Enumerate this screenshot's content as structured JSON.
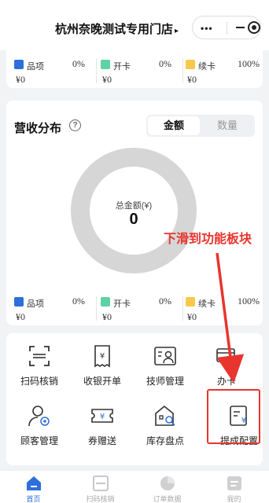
{
  "header": {
    "store_name": "杭州奈晚测试专用门店",
    "dropdown_glyph": "▸"
  },
  "capsule": {
    "more": "•••"
  },
  "summary_legend": [
    {
      "name": "品项",
      "percent": "0%",
      "amount": "¥0",
      "color": "#2e6fdb"
    },
    {
      "name": "开卡",
      "percent": "0%",
      "amount": "¥0",
      "color": "#5fd1a5"
    },
    {
      "name": "续卡",
      "percent": "100%",
      "amount": "¥0",
      "color": "#f7c84a"
    }
  ],
  "revenue": {
    "title": "营收分布",
    "help": "?",
    "toggle": {
      "active": "金额",
      "inactive": "数量"
    },
    "donut_label": "总金额(¥)",
    "donut_value": "0",
    "donut_color": "#d6d6d6"
  },
  "revenue_legend": [
    {
      "name": "品项",
      "percent": "0%",
      "amount": "¥0",
      "color": "#2e6fdb"
    },
    {
      "name": "开卡",
      "percent": "0%",
      "amount": "¥0",
      "color": "#5fd1a5"
    },
    {
      "name": "续卡",
      "percent": "100%",
      "amount": "¥0",
      "color": "#f7c84a"
    }
  ],
  "annotation": {
    "text": "下滑到功能板块",
    "color": "#e8352e"
  },
  "functions": [
    {
      "label": "扫码核销",
      "icon": "scan-icon"
    },
    {
      "label": "收银开单",
      "icon": "receipt-icon"
    },
    {
      "label": "技师管理",
      "icon": "technician-icon"
    },
    {
      "label": "办卡",
      "icon": "card-icon"
    },
    {
      "label": "顾客管理",
      "icon": "customer-icon"
    },
    {
      "label": "券赠送",
      "icon": "coupon-icon"
    },
    {
      "label": "库存盘点",
      "icon": "inventory-icon"
    },
    {
      "label": "提成配置",
      "icon": "commission-icon"
    }
  ],
  "tabbar": [
    {
      "label": "首页",
      "icon": "home-icon",
      "active": true
    },
    {
      "label": "扫码核销",
      "icon": "scan-icon",
      "active": false
    },
    {
      "label": "订单数据",
      "icon": "pie-chart-icon",
      "active": false
    },
    {
      "label": "我的",
      "icon": "profile-icon",
      "active": false
    }
  ]
}
